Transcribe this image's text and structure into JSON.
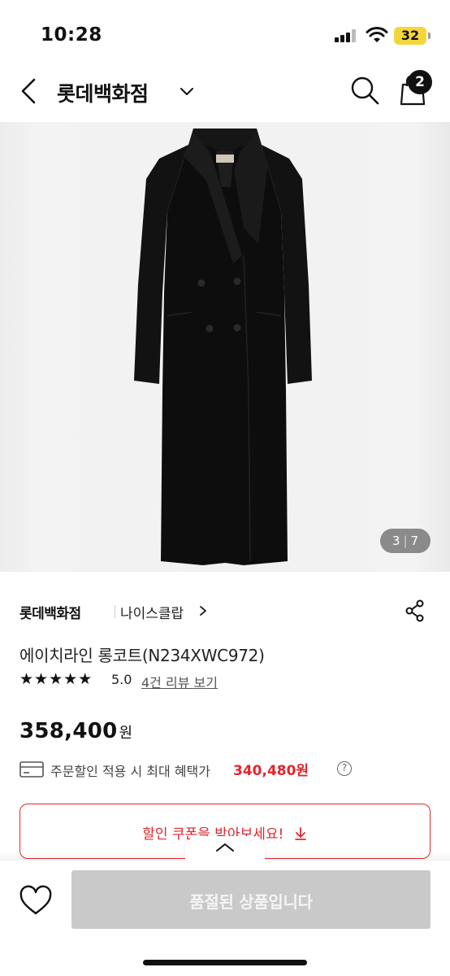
{
  "status_bar": {
    "time": "10:28",
    "battery": "32",
    "icons": [
      "signal-icon",
      "wifi-icon",
      "battery-icon"
    ]
  },
  "header": {
    "store_name": "롯데백화점",
    "cart_count": "2",
    "icons": [
      "back-arrow-icon",
      "chevron-down-icon",
      "search-icon",
      "shopping-bag-icon"
    ]
  },
  "gallery": {
    "current": "3",
    "separator": "|",
    "total": "7"
  },
  "product": {
    "brand": "롯데백화점",
    "shop": "나이스클랍",
    "name": "에이치라인 롱코트(N234XWC972)",
    "stars": "★★★★★",
    "rating": "5.0",
    "review_link": "4건 리뷰 보기",
    "price": "358,400",
    "price_unit": "원",
    "benefit_text": "주문할인 적용 시 최대 혜택가",
    "benefit_price": "340,480원",
    "help_mark": "?",
    "coupon_label": "할인 쿠폰을 받아보세요!"
  },
  "bottom_bar": {
    "buy_label": "품절된 상품입니다"
  },
  "colors": {
    "accent_red": "#e2262e",
    "disabled_button": "#c9c9c9",
    "badge": "#111111",
    "battery": "#f4d63c"
  }
}
